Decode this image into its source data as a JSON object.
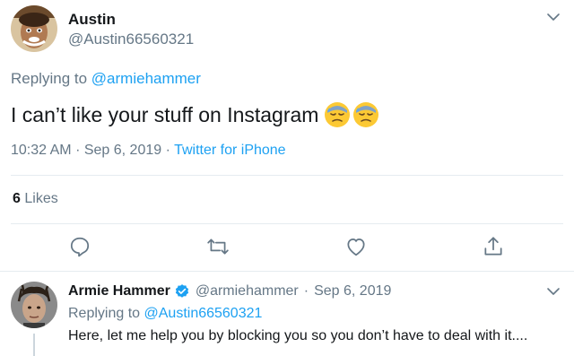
{
  "tweet": {
    "author_name": "Austin",
    "author_handle": "@Austin66560321",
    "replying_prefix": "Replying to",
    "replying_mention": "@armiehammer",
    "text": "I can’t like your stuff on Instagram",
    "emoji": [
      "downcast-face-with-sweat",
      "downcast-face-with-sweat"
    ],
    "time": "10:32 AM",
    "date": "Sep 6, 2019",
    "meta_separator": "·",
    "source": "Twitter for iPhone",
    "likes_count": "6",
    "likes_label": "Likes"
  },
  "actions": {
    "icons": [
      "reply-icon",
      "retweet-icon",
      "like-icon",
      "share-icon"
    ]
  },
  "reply": {
    "author_name": "Armie Hammer",
    "author_handle": "@armiehammer",
    "separator": "·",
    "date": "Sep 6, 2019",
    "replying_prefix": "Replying to",
    "replying_mention": "@Austin66560321",
    "text": "Here, let me help you by blocking you so you don’t have to deal with it...."
  },
  "colors": {
    "text_primary": "#14171a",
    "text_secondary": "#657786",
    "accent": "#1da1f2",
    "divider": "#e6ecf0",
    "verified": "#1da1f2"
  }
}
